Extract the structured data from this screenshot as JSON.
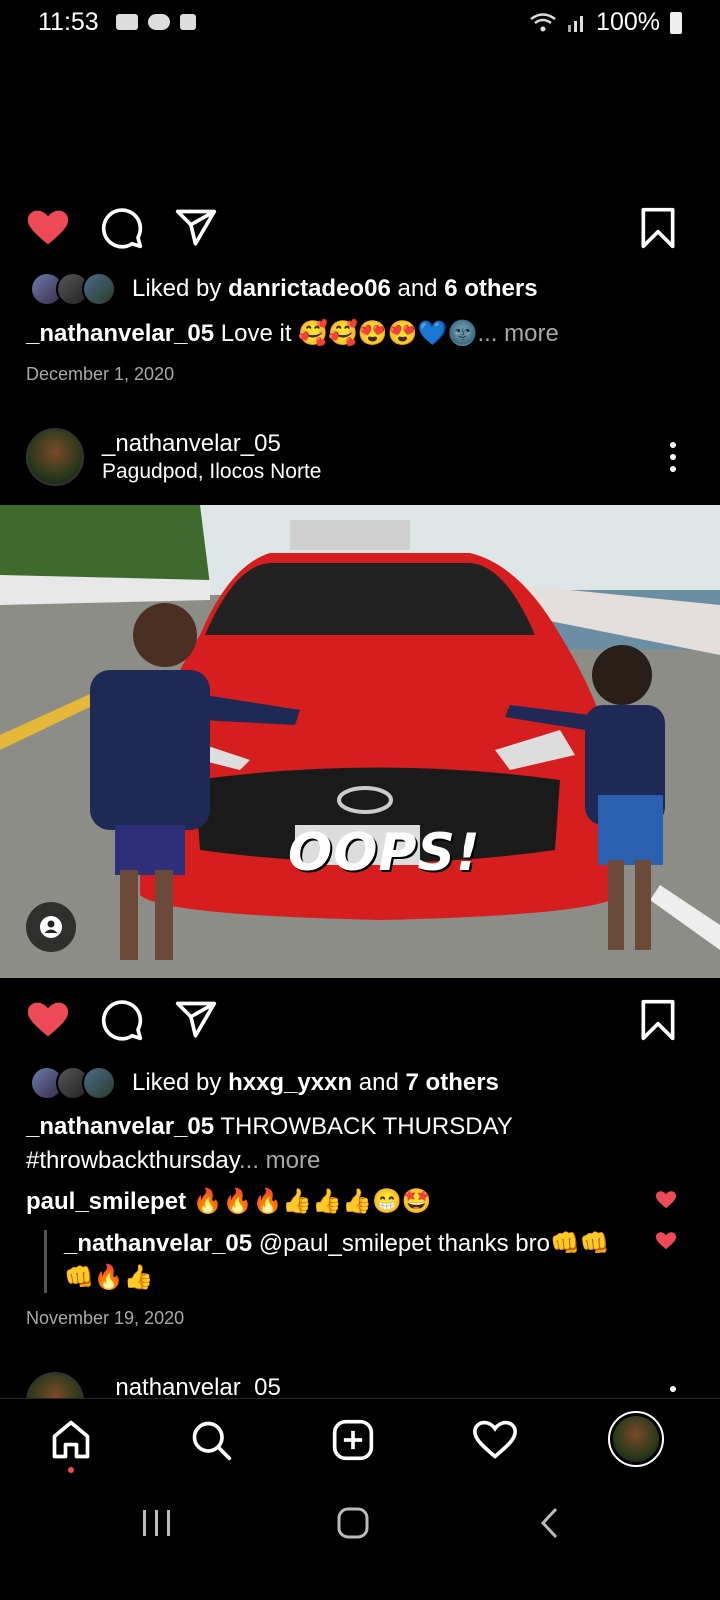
{
  "status_bar": {
    "time": "11:53",
    "battery": "100%"
  },
  "post1": {
    "liked_by_prefix": "Liked by ",
    "liked_by_user": "danrictadeo06",
    "liked_by_and": " and ",
    "liked_by_others": "6 others",
    "caption_user": "_nathanvelar_05",
    "caption_text": " Love it 🥰🥰😍😍💙🌚",
    "caption_more": "... more",
    "date": "December 1, 2020"
  },
  "post2": {
    "username": "_nathanvelar_05",
    "location": "Pagudpod, Ilocos Norte",
    "photo_overlay_text": "OOPS!",
    "liked_by_prefix": "Liked by ",
    "liked_by_user": "hxxg_yxxn",
    "liked_by_and": " and ",
    "liked_by_others": "7 others",
    "caption_user": "_nathanvelar_05",
    "caption_line1": " THROWBACK THURSDAY",
    "caption_line2": "#throwbackthursday",
    "caption_more": "... more",
    "comment1_user": "paul_smilepet",
    "comment1_text": " 🔥🔥🔥👍👍👍😁🤩",
    "reply_user": "_nathanvelar_05",
    "reply_text": " @paul_smilepet thanks bro👊👊",
    "reply_text2": "👊🔥👍",
    "date": "November 19, 2020"
  },
  "post3": {
    "username": "_nathanvelar_05"
  },
  "colors": {
    "like_red": "#ed4956",
    "background": "#000000",
    "muted": "#a8a8a8"
  },
  "icons": [
    "heart-icon",
    "comment-icon",
    "share-icon",
    "bookmark-icon",
    "home-icon",
    "search-icon",
    "create-icon",
    "activity-icon",
    "profile-icon"
  ]
}
